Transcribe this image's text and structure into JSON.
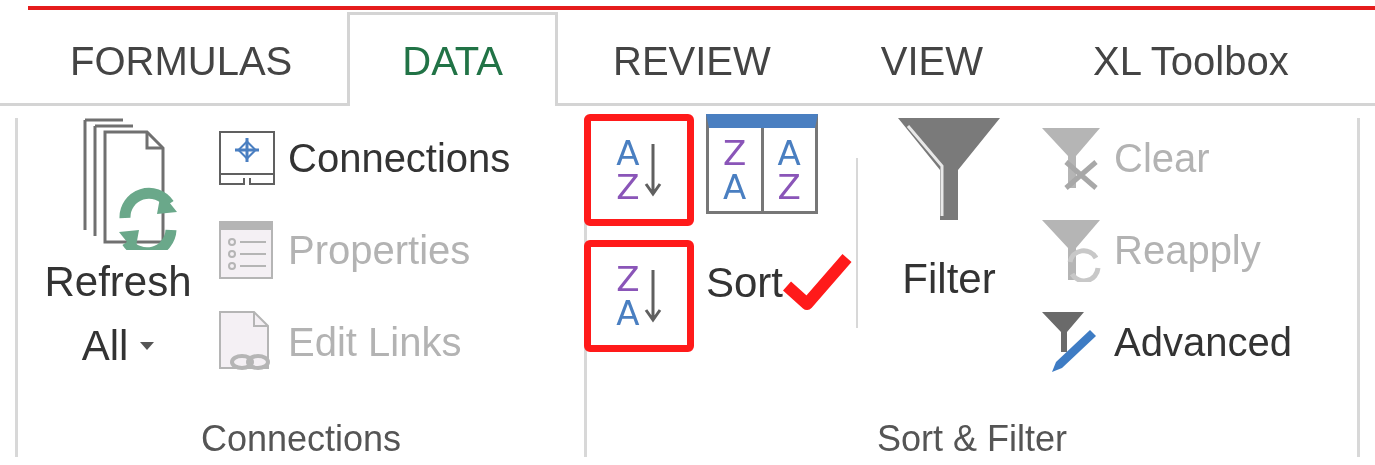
{
  "tabs": [
    {
      "label": "FORMULAS",
      "selected": false
    },
    {
      "label": "DATA",
      "selected": true
    },
    {
      "label": "REVIEW",
      "selected": false
    },
    {
      "label": "VIEW",
      "selected": false
    },
    {
      "label": "XL Toolbox",
      "selected": false
    }
  ],
  "connections_group": {
    "label": "Connections",
    "refresh": {
      "label_lines": [
        "Refresh",
        "All"
      ]
    },
    "items": [
      {
        "label": "Connections",
        "disabled": false,
        "kind": "connections"
      },
      {
        "label": "Properties",
        "disabled": true,
        "kind": "properties"
      },
      {
        "label": "Edit Links",
        "disabled": true,
        "kind": "links"
      }
    ]
  },
  "sort_group": {
    "label": "Sort & Filter",
    "sort_ascending": {
      "letters": [
        {
          "char": "A",
          "color": "#4a7fc1"
        },
        {
          "char": "Z",
          "color": "#8a55b8"
        }
      ]
    },
    "sort_descending": {
      "letters": [
        {
          "char": "Z",
          "color": "#8a55b8"
        },
        {
          "char": "A",
          "color": "#4a7fc1"
        }
      ]
    },
    "sort": {
      "label": "Sort",
      "columns": [
        [
          {
            "char": "Z",
            "color": "#8a55b8"
          },
          {
            "char": "A",
            "color": "#4a7fc1"
          }
        ],
        [
          {
            "char": "A",
            "color": "#4a7fc1"
          },
          {
            "char": "Z",
            "color": "#8a55b8"
          }
        ]
      ]
    },
    "filter": {
      "label": "Filter"
    },
    "items": [
      {
        "label": "Clear",
        "disabled": true,
        "kind": "clear"
      },
      {
        "label": "Reapply",
        "disabled": true,
        "kind": "reapply"
      },
      {
        "label": "Advanced",
        "disabled": false,
        "kind": "advanced"
      }
    ]
  }
}
